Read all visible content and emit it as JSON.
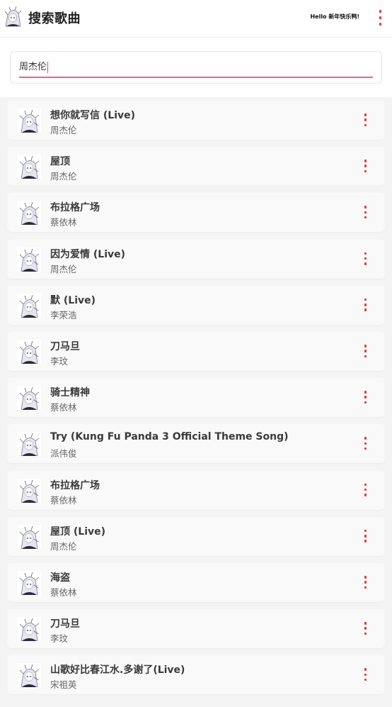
{
  "header": {
    "title": "搜索歌曲",
    "greeting": "Hello 新年快乐鸭!",
    "logo_icon": "anime-avatar-icon",
    "menu_icon": "more-vertical-icon"
  },
  "search": {
    "value": "周杰伦"
  },
  "colors": {
    "accent": "#e53935",
    "underline": "#ec5f8a"
  },
  "songs": [
    {
      "title": "想你就写信 (Live)",
      "artist": "周杰伦"
    },
    {
      "title": "屋顶",
      "artist": "周杰伦"
    },
    {
      "title": "布拉格广场",
      "artist": "蔡依林"
    },
    {
      "title": "因为爱情 (Live)",
      "artist": "周杰伦"
    },
    {
      "title": "默 (Live)",
      "artist": "李荣浩"
    },
    {
      "title": "刀马旦",
      "artist": "李玟"
    },
    {
      "title": "骑士精神",
      "artist": "蔡依林"
    },
    {
      "title": "Try (Kung Fu Panda 3 Official Theme Song)",
      "artist": "派伟俊"
    },
    {
      "title": "布拉格广场",
      "artist": "蔡依林"
    },
    {
      "title": "屋顶 (Live)",
      "artist": "周杰伦"
    },
    {
      "title": "海盗",
      "artist": "蔡依林"
    },
    {
      "title": "刀马旦",
      "artist": "李玟"
    },
    {
      "title": "山歌好比春江水.多谢了(Live)",
      "artist": "宋祖英"
    }
  ]
}
